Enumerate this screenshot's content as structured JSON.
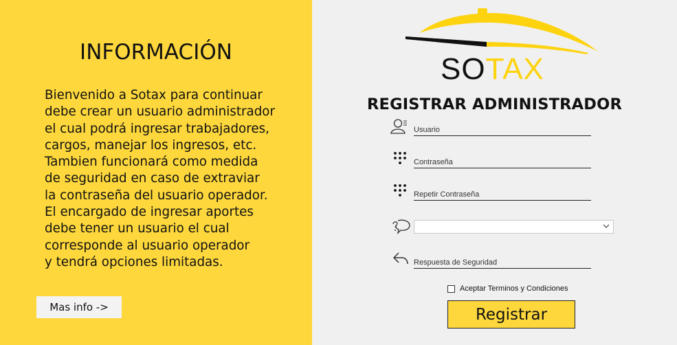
{
  "info": {
    "title": "INFORMACIÓN",
    "body": "Bienvenido a Sotax para continuar\ndebe crear un usuario administrador\nel cual podrá ingresar trabajadores,\ncargos, manejar los ingresos, etc.\nTambien funcionará como medida\nde seguridad en caso de extraviar\nla contraseña del usuario operador.\nEl encargado de ingresar aportes\ndebe tener un usuario el cual\ncorresponde al usuario operador\ny tendrá opciones limitadas.",
    "more_button": "Mas info ->"
  },
  "logo": {
    "part1": "SO",
    "part2": "TAX"
  },
  "form": {
    "title": "REGISTRAR ADMINISTRADOR",
    "username_placeholder": "Usuario",
    "password_placeholder": "Contraseña",
    "repeat_password_placeholder": "Repetir Contraseña",
    "security_question_value": "",
    "security_answer_placeholder": "Respuesta de Seguridad",
    "terms_label": "Aceptar Terminos y Condiciones",
    "terms_checked": false,
    "submit_label": "Registrar"
  },
  "icons": {
    "username": "user-icon",
    "password": "keypad-dots-icon",
    "repeat_password": "keypad-dots-icon",
    "question": "question-bubble-icon",
    "answer": "reply-arrow-icon",
    "dropdown": "chevron-down-icon"
  },
  "colors": {
    "left_panel": "#fdd73c",
    "logo_accent": "#fdd30f",
    "right_panel": "#f0f0f0"
  }
}
